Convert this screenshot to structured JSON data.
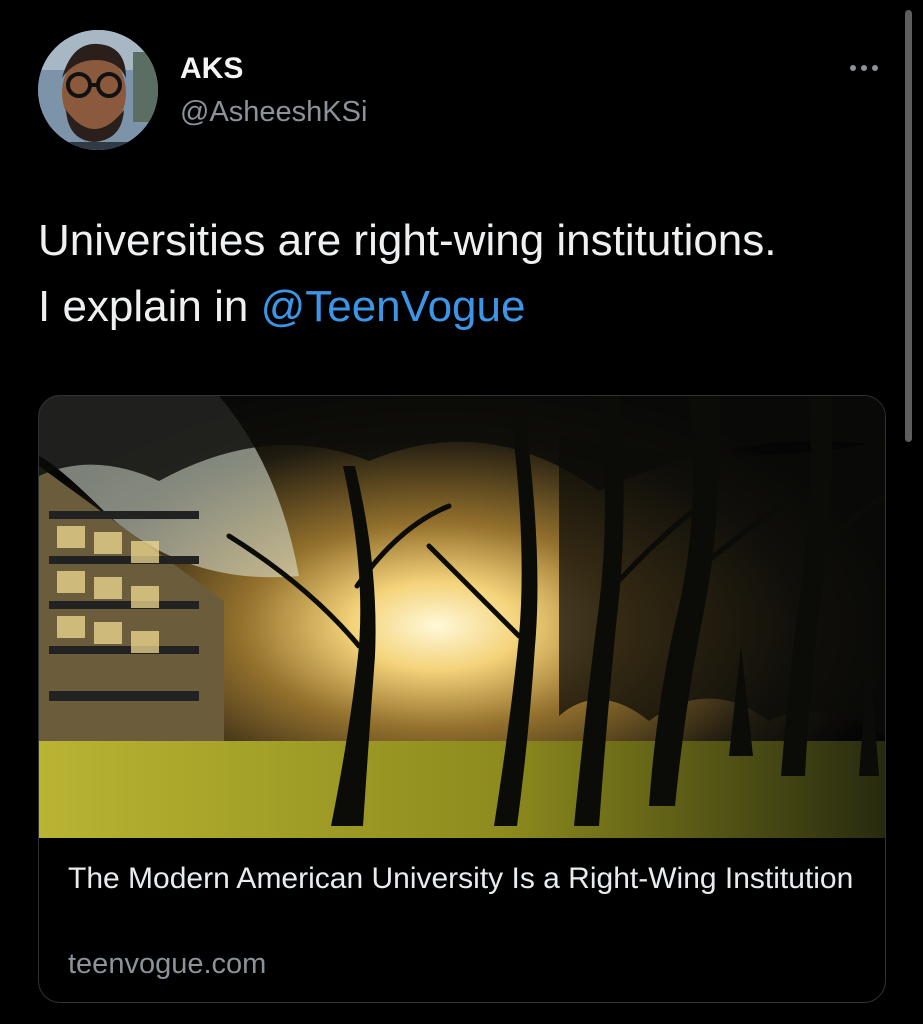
{
  "author": {
    "display_name": "AKS",
    "handle": "@AsheeshKSi"
  },
  "tweet": {
    "text_line1": "Universities are right-wing institutions.",
    "text_line2_prefix": "I explain in ",
    "mention": "@TeenVogue"
  },
  "link_card": {
    "title": "The Modern American University Is a Right-Wing Institution",
    "domain": "teenvogue.com"
  },
  "colors": {
    "background": "#000000",
    "link": "#3d95e8",
    "muted_text": "#8b9299",
    "card_border": "#2f3336"
  },
  "icons": {
    "more": "more-horizontal-icon"
  }
}
